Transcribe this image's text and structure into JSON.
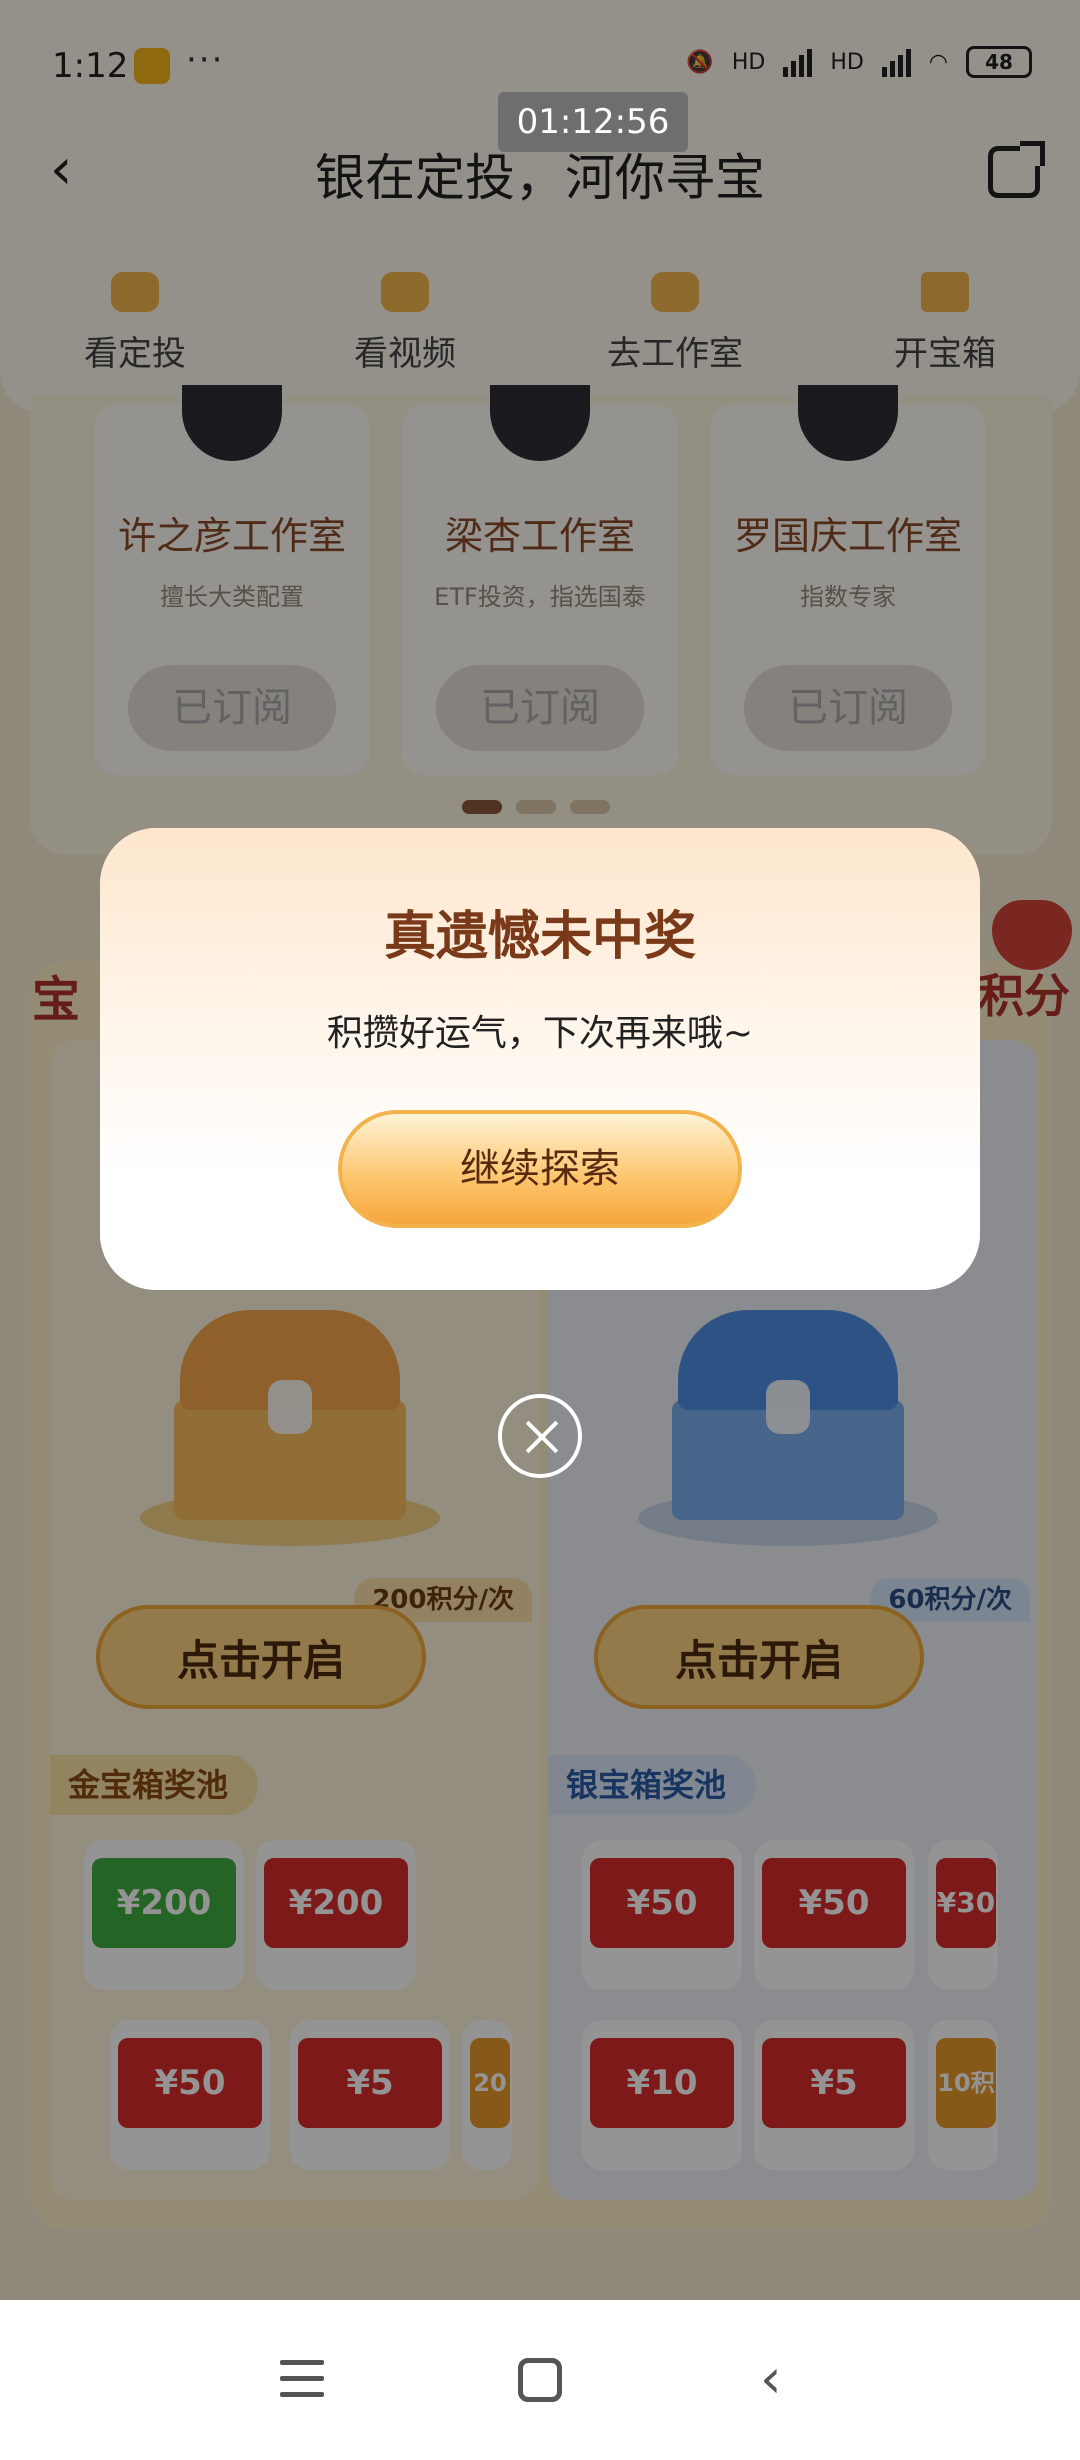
{
  "status_bar": {
    "time": "1:12",
    "dots": "···",
    "network1": "HD",
    "network2": "HD",
    "battery": "48",
    "recording_time": "01:12:56"
  },
  "header": {
    "back": "‹",
    "title": "银在定投，河你寻宝"
  },
  "nav": {
    "items": [
      {
        "label": "看定投"
      },
      {
        "label": "看视频"
      },
      {
        "label": "去工作室"
      },
      {
        "label": "开宝箱"
      }
    ]
  },
  "studios": [
    {
      "name": "许之彦工作室",
      "desc": "擅长大类配置",
      "button": "已订阅"
    },
    {
      "name": "梁杏工作室",
      "desc": "ETF投资，指选国泰",
      "button": "已订阅"
    },
    {
      "name": "罗国庆工作室",
      "desc": "指数专家",
      "button": "已订阅"
    }
  ],
  "treasure": {
    "label_left": "宝",
    "label_right": "积分",
    "gold": {
      "cost": "200积分/次",
      "open_button": "点击开启",
      "pool_title": "金宝箱奖池",
      "prizes": [
        "¥200",
        "¥200",
        "¥50",
        "¥5",
        "20"
      ]
    },
    "silver": {
      "cost": "60积分/次",
      "open_button": "点击开启",
      "pool_title": "银宝箱奖池",
      "prizes": [
        "¥50",
        "¥50",
        "¥30",
        "¥10",
        "¥5",
        "10积"
      ]
    }
  },
  "modal": {
    "title": "真遗憾未中奖",
    "message": "积攒好运气，下次再来哦~",
    "button": "继续探索"
  },
  "colors": {
    "accent_brown": "#7a3a1a",
    "button_orange": "#fcc46a",
    "overlay": "rgba(0,0,0,0.42)"
  }
}
